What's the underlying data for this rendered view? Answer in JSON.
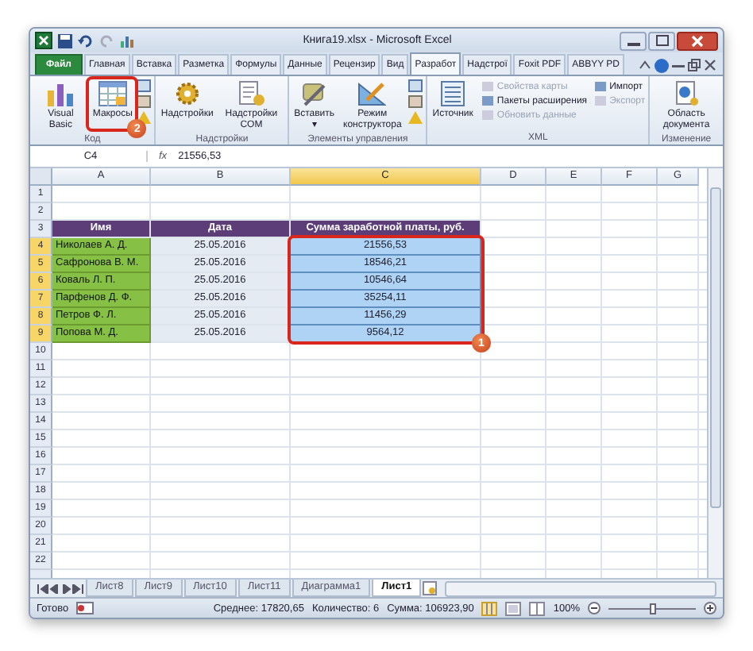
{
  "window": {
    "title": "Книга19.xlsx - Microsoft Excel"
  },
  "tabs": [
    {
      "label": "Файл",
      "kind": "file",
      "selected": false
    },
    {
      "label": "Главная",
      "kind": "tab",
      "selected": false
    },
    {
      "label": "Вставка",
      "kind": "tab",
      "selected": false
    },
    {
      "label": "Разметка",
      "kind": "tab",
      "selected": false
    },
    {
      "label": "Формулы",
      "kind": "tab",
      "selected": false
    },
    {
      "label": "Данные",
      "kind": "tab",
      "selected": false
    },
    {
      "label": "Рецензир",
      "kind": "tab",
      "selected": false
    },
    {
      "label": "Вид",
      "kind": "tab",
      "selected": false
    },
    {
      "label": "Разработ",
      "kind": "tab",
      "selected": true
    },
    {
      "label": "Надстрої",
      "kind": "tab",
      "selected": false
    },
    {
      "label": "Foxit PDF",
      "kind": "tab",
      "selected": false
    },
    {
      "label": "ABBYY PD",
      "kind": "tab",
      "selected": false
    }
  ],
  "ribbon_groups": [
    {
      "label": "Код",
      "items": [
        {
          "kind": "large",
          "label": "Visual Basic",
          "disabled": false
        },
        {
          "kind": "large",
          "label": "Макросы",
          "disabled": false,
          "annotation": "2"
        },
        {
          "kind": "icons"
        }
      ]
    },
    {
      "label": "Надстройки",
      "items": [
        {
          "kind": "large",
          "label": "Надстройки",
          "disabled": false
        },
        {
          "kind": "large",
          "label": "Надстройки COM",
          "disabled": false
        }
      ]
    },
    {
      "label": "Элементы управления",
      "items": [
        {
          "kind": "large",
          "label": "Вставить",
          "disabled": false,
          "dropdown": "▾"
        },
        {
          "kind": "large",
          "label": "Режим конструктора",
          "disabled": false
        },
        {
          "kind": "icons"
        }
      ]
    },
    {
      "label": "XML",
      "items": [
        {
          "kind": "large",
          "label": "Источник",
          "disabled": false
        },
        {
          "kind": "small",
          "label": "Свойства карты",
          "disabled": true
        },
        {
          "kind": "small",
          "label": "Пакеты расширения",
          "disabled": false
        },
        {
          "kind": "small",
          "label": "Обновить данные",
          "disabled": true
        },
        {
          "kind": "small",
          "label": "Импорт",
          "disabled": false
        },
        {
          "kind": "small",
          "label": "Экспорт",
          "disabled": true
        }
      ]
    },
    {
      "label": "Изменение",
      "items": [
        {
          "kind": "large",
          "label": "Область документа",
          "disabled": false
        }
      ]
    }
  ],
  "formula_bar": {
    "name_box": "C4",
    "fx": "fx",
    "value": "21556,53"
  },
  "columns": [
    {
      "label": "A",
      "selected": false
    },
    {
      "label": "B",
      "selected": false
    },
    {
      "label": "C",
      "selected": true
    },
    {
      "label": "D",
      "selected": false
    },
    {
      "label": "E",
      "selected": false
    },
    {
      "label": "F",
      "selected": false
    },
    {
      "label": "G",
      "selected": false
    }
  ],
  "rows": [
    {
      "number": "1",
      "selected": false,
      "cells": []
    },
    {
      "number": "2",
      "selected": false,
      "cells": []
    },
    {
      "number": "3",
      "selected": false,
      "cells": [
        {
          "kind": "header",
          "text": "Имя"
        },
        {
          "kind": "header",
          "text": "Дата"
        },
        {
          "kind": "header",
          "text": "Сумма заработной платы, руб."
        }
      ]
    },
    {
      "number": "4",
      "selected": true,
      "cells": [
        {
          "kind": "name",
          "text": "Николаев А. Д."
        },
        {
          "kind": "date",
          "text": "25.05.2016"
        },
        {
          "kind": "sum",
          "text": "21556,53"
        }
      ]
    },
    {
      "number": "5",
      "selected": true,
      "cells": [
        {
          "kind": "name",
          "text": "Сафронова В. М."
        },
        {
          "kind": "date",
          "text": "25.05.2016"
        },
        {
          "kind": "sum",
          "text": "18546,21"
        }
      ]
    },
    {
      "number": "6",
      "selected": true,
      "cells": [
        {
          "kind": "name",
          "text": "Коваль Л. П."
        },
        {
          "kind": "date",
          "text": "25.05.2016"
        },
        {
          "kind": "sum",
          "text": "10546,64"
        }
      ]
    },
    {
      "number": "7",
      "selected": true,
      "cells": [
        {
          "kind": "name",
          "text": "Парфенов Д. Ф."
        },
        {
          "kind": "date",
          "text": "25.05.2016"
        },
        {
          "kind": "sum",
          "text": "35254,11"
        }
      ]
    },
    {
      "number": "8",
      "selected": true,
      "cells": [
        {
          "kind": "name",
          "text": "Петров Ф. Л."
        },
        {
          "kind": "date",
          "text": "25.05.2016"
        },
        {
          "kind": "sum",
          "text": "11456,29"
        }
      ]
    },
    {
      "number": "9",
      "selected": true,
      "cells": [
        {
          "kind": "name",
          "text": "Попова М. Д."
        },
        {
          "kind": "date",
          "text": "25.05.2016"
        },
        {
          "kind": "sum",
          "text": "9564,12"
        }
      ]
    },
    {
      "number": "10",
      "selected": false,
      "cells": []
    },
    {
      "number": "11",
      "selected": false,
      "cells": []
    },
    {
      "number": "12",
      "selected": false,
      "cells": []
    },
    {
      "number": "13",
      "selected": false,
      "cells": []
    },
    {
      "number": "14",
      "selected": false,
      "cells": []
    },
    {
      "number": "15",
      "selected": false,
      "cells": []
    },
    {
      "number": "16",
      "selected": false,
      "cells": []
    },
    {
      "number": "17",
      "selected": false,
      "cells": []
    },
    {
      "number": "18",
      "selected": false,
      "cells": []
    },
    {
      "number": "19",
      "selected": false,
      "cells": []
    },
    {
      "number": "20",
      "selected": false,
      "cells": []
    },
    {
      "number": "21",
      "selected": false,
      "cells": []
    },
    {
      "number": "22",
      "selected": false,
      "cells": []
    }
  ],
  "range_annotation": "1",
  "sheet_tabs": [
    {
      "label": "Лист8",
      "selected": false
    },
    {
      "label": "Лист9",
      "selected": false
    },
    {
      "label": "Лист10",
      "selected": false
    },
    {
      "label": "Лист11",
      "selected": false
    },
    {
      "label": "Диаграмма1",
      "selected": false
    },
    {
      "label": "Лист1",
      "selected": true
    }
  ],
  "status_bar": {
    "mode": "Готово",
    "average": "Среднее: 17820,65",
    "count": "Количество: 6",
    "sum": "Сумма: 106923,90",
    "zoom": "100%",
    "zoom_level": {
      "level": 0.5
    }
  }
}
